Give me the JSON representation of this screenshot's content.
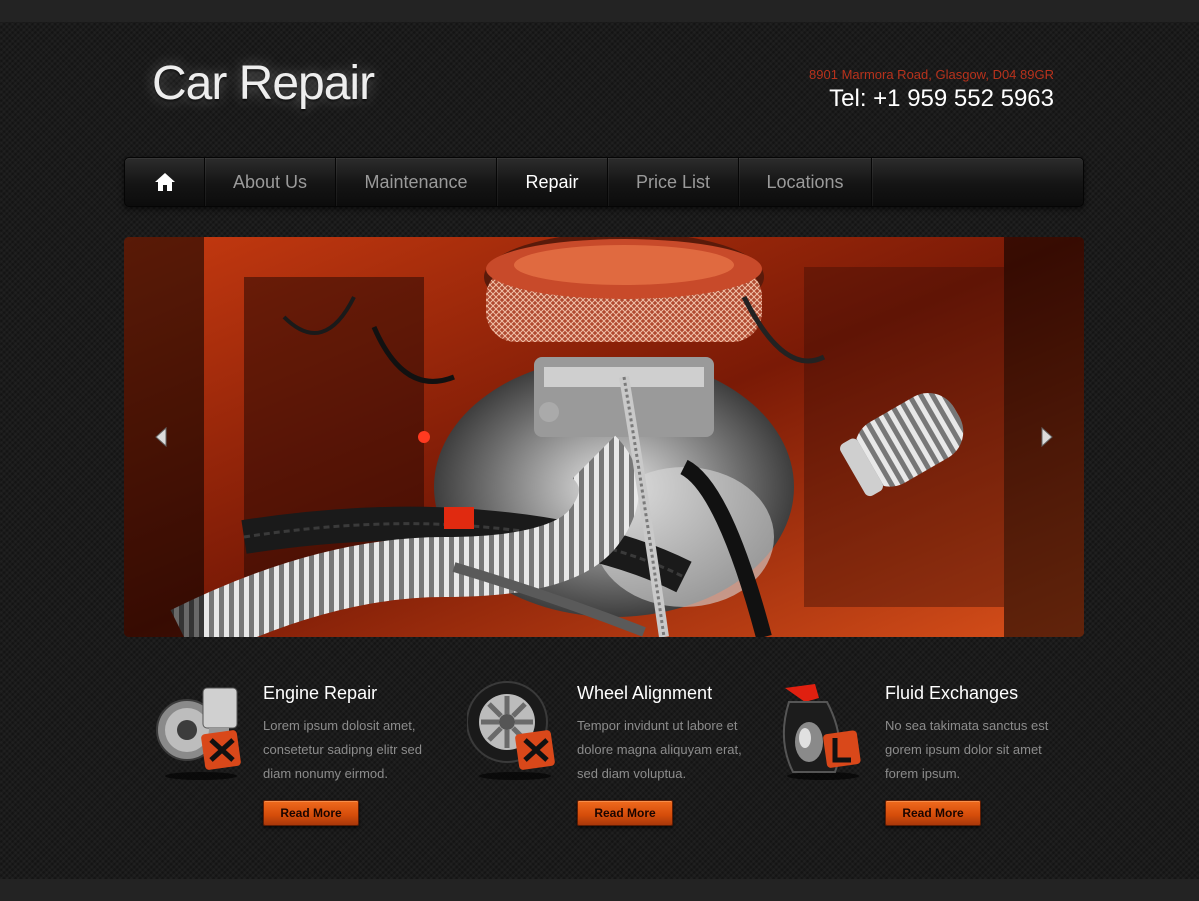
{
  "header": {
    "logo_text": "Car Repair",
    "address": "8901 Marmora Road, Glasgow, D04 89GR",
    "tel": "Tel: +1 959 552 5963"
  },
  "nav": {
    "home_icon": "home-icon",
    "items": [
      {
        "label": "About Us",
        "active": false
      },
      {
        "label": "Maintenance",
        "active": false
      },
      {
        "label": "Repair",
        "active": true
      },
      {
        "label": "Price List",
        "active": false
      },
      {
        "label": "Locations",
        "active": false
      }
    ]
  },
  "slider": {
    "image": "car-engine-bay-photo",
    "prev_icon": "arrow-left-icon",
    "next_icon": "arrow-right-icon"
  },
  "features": [
    {
      "icon": "engine-repair-icon",
      "title": "Engine Repair",
      "desc_lines": [
        "Lorem ipsum dolosit amet,",
        "consetetur sadipng elitr sed",
        "diam nonumy eirmod."
      ],
      "button": "Read More"
    },
    {
      "icon": "wheel-alignment-icon",
      "title": "Wheel Alignment",
      "desc_lines": [
        "Tempor invidunt ut labore et",
        "dolore magna aliquyam erat,",
        "sed diam voluptua."
      ],
      "button": "Read More"
    },
    {
      "icon": "fluid-exchange-icon",
      "title": "Fluid Exchanges",
      "desc_lines": [
        "No sea takimata sanctus est",
        "gorem ipsum dolor sit amet",
        "forem ipsum."
      ],
      "button": "Read More"
    }
  ],
  "colors": {
    "accent": "#d9531a",
    "address": "#b8321c",
    "background": "#1b1b1b",
    "nav_text": "#9a9a9a",
    "nav_active": "#ffffff"
  }
}
